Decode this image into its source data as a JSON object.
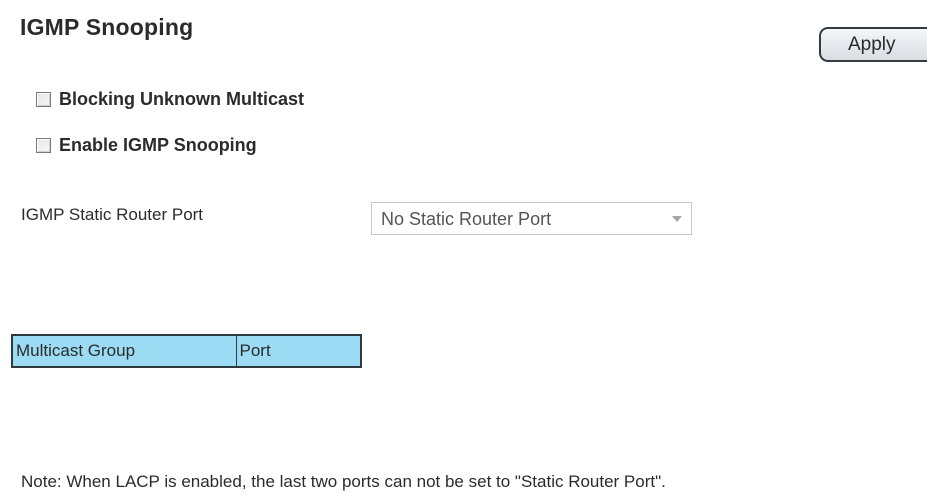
{
  "page": {
    "title": "IGMP Snooping"
  },
  "toolbar": {
    "apply_label": "Apply"
  },
  "options": {
    "blocking_unknown_multicast": {
      "label": "Blocking Unknown Multicast",
      "checked": false
    },
    "enable_igmp_snooping": {
      "label": "Enable IGMP Snooping",
      "checked": false
    }
  },
  "static_router_port": {
    "label": "IGMP Static Router Port",
    "selected": "No Static Router Port"
  },
  "table": {
    "columns": [
      "Multicast Group",
      "Port"
    ],
    "rows": []
  },
  "note": "Note: When LACP is enabled, the last two ports can not be set to \"Static Router Port\"."
}
